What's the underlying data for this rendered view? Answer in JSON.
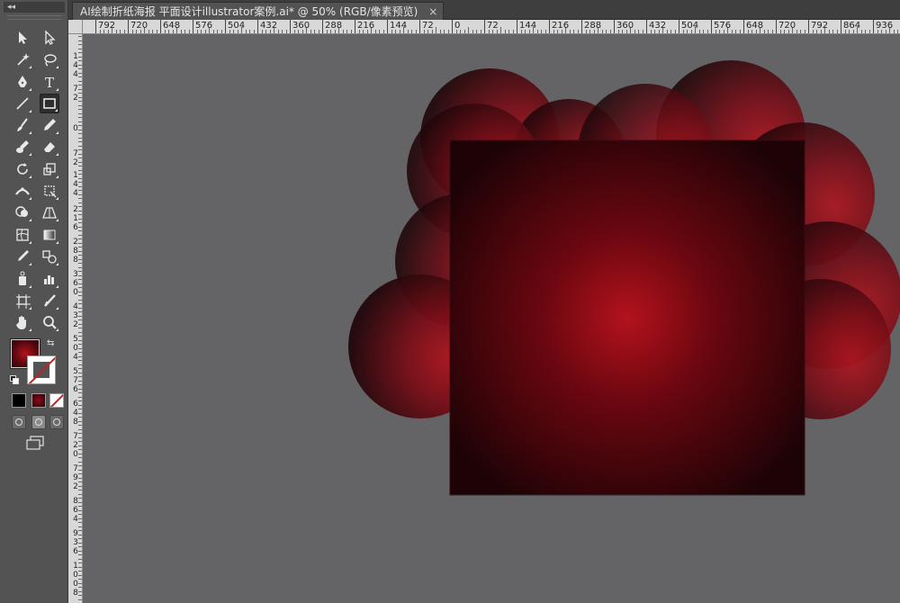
{
  "document": {
    "tab_title": "AI绘制折纸海报 平面设计illustrator案例.ai* @ 50% (RGB/像素预览)",
    "close_glyph": "×"
  },
  "toolbar": {
    "collapse_glyph": "◂◂",
    "tools": [
      {
        "name": "selection-tool-icon",
        "glyph": "sel"
      },
      {
        "name": "direct-selection-tool-icon",
        "glyph": "dsel"
      },
      {
        "name": "magic-wand-tool-icon",
        "glyph": "wand"
      },
      {
        "name": "lasso-tool-icon",
        "glyph": "lasso"
      },
      {
        "name": "pen-tool-icon",
        "glyph": "pen"
      },
      {
        "name": "type-tool-icon",
        "glyph": "T"
      },
      {
        "name": "line-segment-tool-icon",
        "glyph": "line"
      },
      {
        "name": "rectangle-tool-icon",
        "glyph": "rect"
      },
      {
        "name": "paintbrush-tool-icon",
        "glyph": "brush"
      },
      {
        "name": "pencil-tool-icon",
        "glyph": "pencil"
      },
      {
        "name": "blob-brush-tool-icon",
        "glyph": "blob"
      },
      {
        "name": "eraser-tool-icon",
        "glyph": "eraser"
      },
      {
        "name": "rotate-tool-icon",
        "glyph": "rotate"
      },
      {
        "name": "scale-tool-icon",
        "glyph": "scale"
      },
      {
        "name": "width-tool-icon",
        "glyph": "width"
      },
      {
        "name": "free-transform-tool-icon",
        "glyph": "freetrans"
      },
      {
        "name": "shape-builder-tool-icon",
        "glyph": "shapebuilder"
      },
      {
        "name": "perspective-grid-tool-icon",
        "glyph": "persp"
      },
      {
        "name": "mesh-tool-icon",
        "glyph": "mesh"
      },
      {
        "name": "gradient-tool-icon",
        "glyph": "gradient"
      },
      {
        "name": "eyedropper-tool-icon",
        "glyph": "eyedrop"
      },
      {
        "name": "blend-tool-icon",
        "glyph": "blend"
      },
      {
        "name": "symbol-sprayer-tool-icon",
        "glyph": "symbol"
      },
      {
        "name": "column-graph-tool-icon",
        "glyph": "graph"
      },
      {
        "name": "artboard-tool-icon",
        "glyph": "artboard"
      },
      {
        "name": "slice-tool-icon",
        "glyph": "slice"
      },
      {
        "name": "hand-tool-icon",
        "glyph": "hand"
      },
      {
        "name": "zoom-tool-icon",
        "glyph": "zoom"
      }
    ],
    "fill_color": "#8a0c16",
    "stroke_color": "none"
  },
  "rulers": {
    "top_labels": [
      "792",
      "720",
      "648",
      "576",
      "504",
      "432",
      "360",
      "288",
      "216",
      "144",
      "72",
      "0",
      "72",
      "144",
      "216",
      "288",
      "360",
      "432",
      "504",
      "576",
      "648",
      "720",
      "792",
      "864",
      "936"
    ],
    "left_groups": [
      [
        "1",
        "4",
        "4"
      ],
      [
        "7",
        "2"
      ],
      [
        "0"
      ],
      [
        "7",
        "2"
      ],
      [
        "1",
        "4",
        "4"
      ],
      [
        "2",
        "1",
        "6"
      ],
      [
        "2",
        "8",
        "8"
      ],
      [
        "3",
        "6",
        "0"
      ],
      [
        "4",
        "3",
        "2"
      ],
      [
        "5",
        "0",
        "4"
      ],
      [
        "5",
        "7",
        "6"
      ],
      [
        "6",
        "4",
        "8"
      ],
      [
        "7",
        "2",
        "0"
      ],
      [
        "7",
        "9",
        "2"
      ],
      [
        "8",
        "6",
        "4"
      ],
      [
        "9",
        "3",
        "6"
      ],
      [
        "1",
        "0",
        "0",
        "8"
      ]
    ]
  },
  "colors": {
    "canvas_bg": "#646366",
    "accent_red": "#b3121c",
    "dark_red": "#1e0306"
  }
}
